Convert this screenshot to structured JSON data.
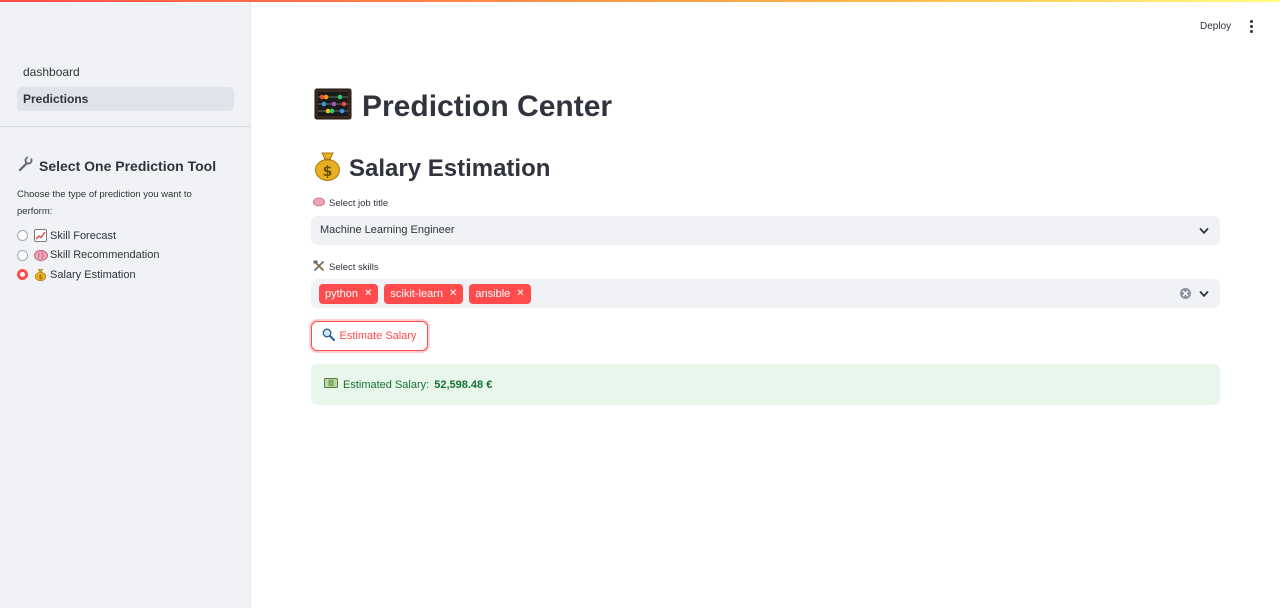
{
  "sidebar": {
    "nav": [
      {
        "label": "dashboard",
        "active": false
      },
      {
        "label": "Predictions",
        "active": true
      }
    ],
    "heading": "Select One Prediction Tool",
    "heading_icon": "wrench-icon",
    "caption": "Choose the type of prediction you want to perform:",
    "options": [
      {
        "label": "Skill Forecast",
        "icon": "chart-increasing-icon",
        "selected": false
      },
      {
        "label": "Skill Recommendation",
        "icon": "brain-icon",
        "selected": false
      },
      {
        "label": "Salary Estimation",
        "icon": "money-bag-icon",
        "selected": true
      }
    ]
  },
  "header": {
    "deploy_label": "Deploy",
    "menu_icon": "kebab-menu-icon"
  },
  "main": {
    "title": "Prediction Center",
    "title_icon": "abacus-icon",
    "subtitle": "Salary Estimation",
    "subtitle_icon": "money-bag-icon",
    "job_title": {
      "label": "Select job title",
      "icon": "brain-icon",
      "value": "Machine Learning Engineer"
    },
    "skills": {
      "label": "Select skills",
      "icon": "hammer-wrench-icon",
      "tags": [
        "python",
        "scikit-learn",
        "ansible"
      ]
    },
    "estimate_button": {
      "label": "Estimate Salary",
      "icon": "magnifier-icon"
    },
    "result": {
      "icon": "banknote-icon",
      "prefix": "Estimated Salary:",
      "value": "52,598.48 €"
    }
  },
  "colors": {
    "accent": "#ff4b4b",
    "sidebar_bg": "#f0f2f6",
    "success_bg": "#e8f6ec",
    "success_text": "#177233"
  }
}
